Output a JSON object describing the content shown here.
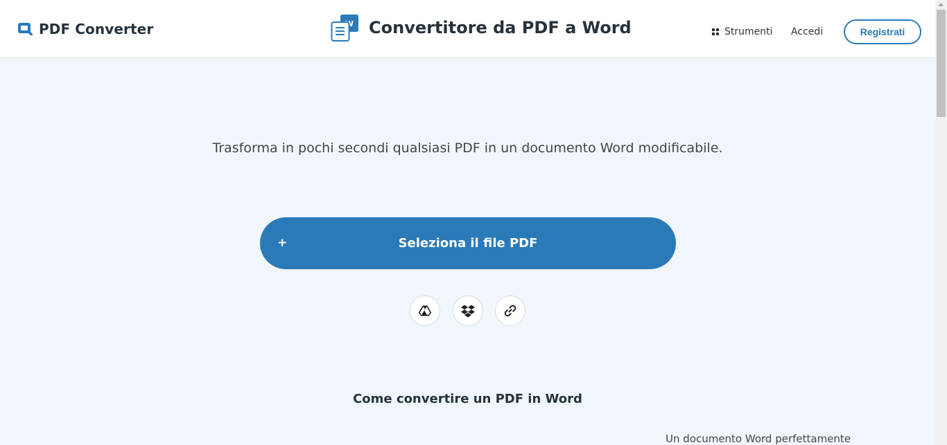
{
  "header": {
    "logo_text": "PDF Converter",
    "page_title": "Convertitore da PDF a Word",
    "nav": {
      "tools_label": "Strumenti",
      "login_label": "Accedi",
      "register_label": "Registrati"
    }
  },
  "main": {
    "subtitle": "Trasforma in pochi secondi qualsiasi PDF in un documento Word modificabile.",
    "select_button": {
      "plus": "+",
      "label": "Seleziona il file PDF"
    },
    "cloud_icons": [
      "google-drive-icon",
      "dropbox-icon",
      "link-icon"
    ],
    "how_to_title": "Come convertire un PDF in Word",
    "teaser_text": "Un documento Word perfettamente"
  },
  "colors": {
    "accent": "#2a7ab8",
    "background": "#f0f6fc",
    "header_bg": "#ffffff",
    "text_dark": "#26323c"
  }
}
